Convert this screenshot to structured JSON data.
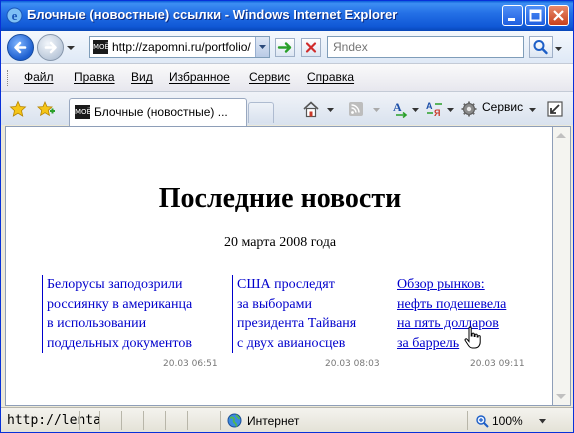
{
  "window": {
    "title": "Блочные (новостные) ссылки - Windows Internet Explorer"
  },
  "addressbar": {
    "url": "http://zapomni.ru/portfolio/",
    "favicon_text": "МОЁ"
  },
  "search": {
    "placeholder": "Яndex"
  },
  "menu": {
    "items": [
      "Файл",
      "Правка",
      "Вид",
      "Избранное",
      "Сервис",
      "Справка"
    ]
  },
  "tabs": [
    {
      "label": "Блочные (новостные) ...",
      "favicon_text": "МОЁ"
    }
  ],
  "toolbar": {
    "tools_label": "Сервис"
  },
  "page": {
    "headline": "Последние новости",
    "date": "20 марта 2008 года",
    "news": [
      {
        "lines": [
          "Белорусы заподозрили",
          "россиянку в американца",
          "в использовании",
          "поддельных документов"
        ],
        "time": "20.03 06:51"
      },
      {
        "lines": [
          "США проследят",
          "за выборами",
          "президента Тайваня",
          "с двух авианосцев"
        ],
        "time": "20.03 08:03"
      },
      {
        "lines": [
          "Обзор рынков:",
          "нефть подешевела",
          "на пять долларов",
          "за баррель"
        ],
        "time": "20.03 09:11"
      }
    ]
  },
  "statusbar": {
    "status_text": "http://lenta",
    "zone": "Интернет",
    "zoom": "100%"
  },
  "colors": {
    "titlebar": "#2470e6",
    "link": "#0000cc"
  }
}
